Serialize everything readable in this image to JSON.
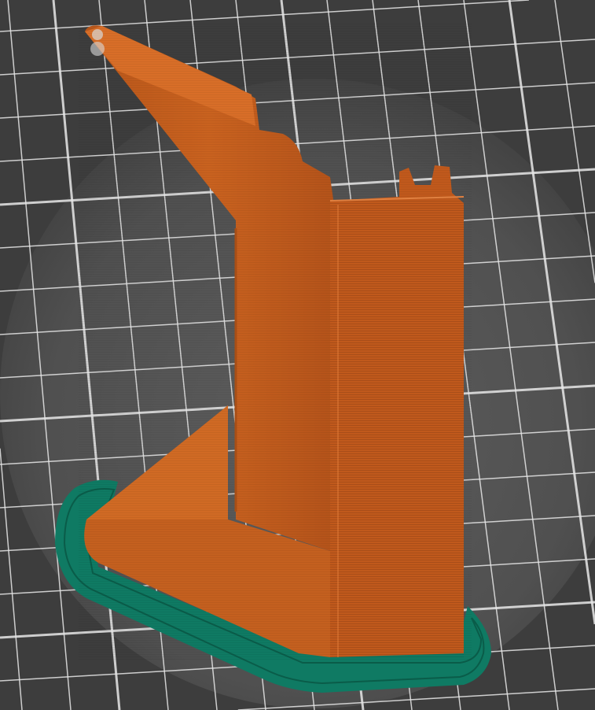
{
  "viewport": {
    "view": "3d-preview",
    "colors": {
      "background": "#3d3d3d",
      "bed_glow": "#585858",
      "grid_line": "#e8e8e8",
      "model_perimeter": "#c8601e",
      "model_shadow": "#a84e16",
      "brim": "#0f7a63"
    }
  }
}
